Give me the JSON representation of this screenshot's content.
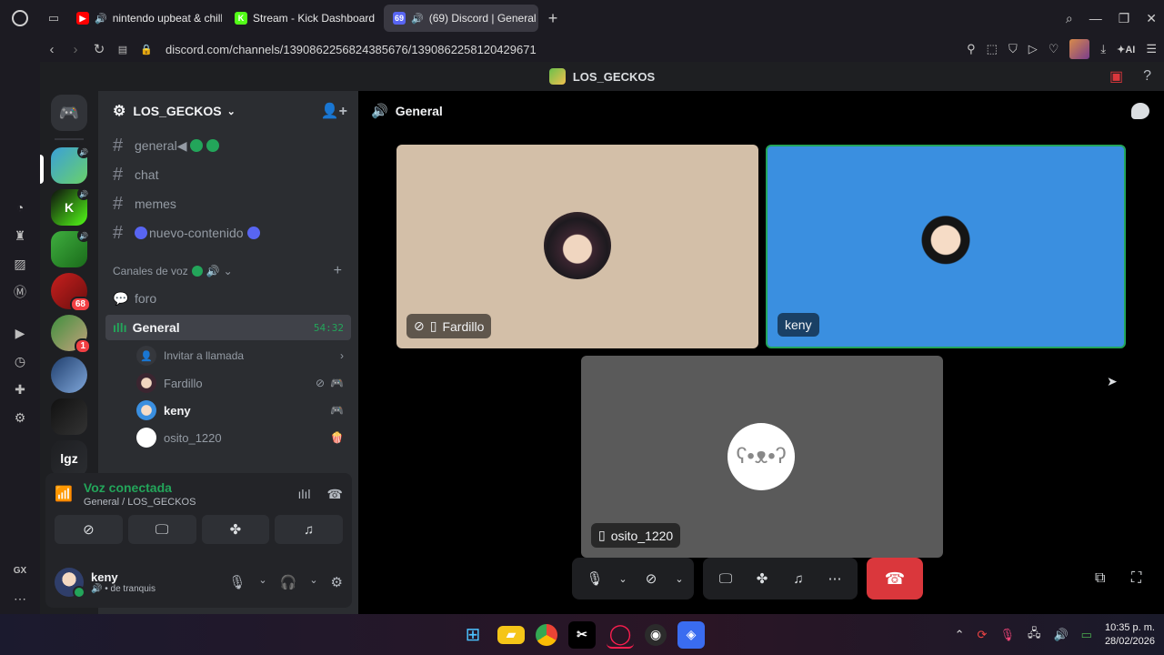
{
  "browser": {
    "tabs": [
      {
        "label": "nintendo upbeat & chill",
        "icon": "youtube-icon",
        "color": "#ff0000",
        "glyph": "▶",
        "audio": true
      },
      {
        "label": "Stream - Kick Dashboard",
        "icon": "kick-icon",
        "color": "#53fc18",
        "glyph": "K",
        "audio": false
      },
      {
        "label": "(69) Discord | General",
        "icon": "discord-icon",
        "color": "#5865f2",
        "glyph": "69",
        "audio": true,
        "active": true
      }
    ],
    "new_tab": "+",
    "url": "discord.com/channels/1390862256824385676/1390862258120429671",
    "ai_label": "AI"
  },
  "discord": {
    "window_title": "LOS_GECKOS",
    "guild_name": "LOS_GECKOS",
    "text_channels": [
      {
        "name": "general◀",
        "dots": [
          "#23a55a",
          "#23a55a"
        ],
        "bold": false
      },
      {
        "name": "chat",
        "dots": []
      },
      {
        "name": "memes",
        "dots": []
      },
      {
        "name": "nuevo-contenido",
        "dots_before": "#5865f2",
        "dots": [
          "#5865f2"
        ]
      }
    ],
    "voice_category": "Canales de voz",
    "forum_channel": "foro",
    "voice_channel": {
      "name": "General",
      "timer": "54:32"
    },
    "invite": "Invitar a llamada",
    "voice_users": [
      {
        "name": "Fardillo",
        "me": false
      },
      {
        "name": "keny",
        "me": true
      },
      {
        "name": "osito_1220",
        "me": false
      }
    ],
    "voice_panel": {
      "status": "Voz conectada",
      "location": "General / LOS_GECKOS"
    },
    "user": {
      "name": "keny",
      "status": "de tranquis"
    },
    "header_channel": "General",
    "servers": [
      {
        "badge": "",
        "colors": [
          "#3aa0d8",
          "#6ad16a"
        ],
        "glyph": ""
      },
      {
        "badge": "",
        "colors": [
          "#0e0e0e",
          "#53fc18"
        ],
        "glyph": "K"
      },
      {
        "badge": "",
        "colors": [
          "#3fae3f",
          "#1a6b1a"
        ],
        "glyph": ""
      },
      {
        "badge": "68",
        "colors": [
          "#c8201e",
          "#6a0e0e"
        ],
        "glyph": ""
      },
      {
        "badge": "1",
        "colors": [
          "#3d8f3d",
          "#c4a27c"
        ],
        "glyph": ""
      },
      {
        "badge": "",
        "colors": [
          "#1f3e6d",
          "#7fa6d9"
        ],
        "glyph": ""
      },
      {
        "badge": "",
        "colors": [
          "#111111",
          "#333333"
        ],
        "glyph": ""
      },
      {
        "badge": "",
        "colors": [
          "#1e1f22",
          "#2b2d31"
        ],
        "glyph": "lgz"
      }
    ],
    "tiles": [
      {
        "name": "Fardillo",
        "bg": "#d3bfa8"
      },
      {
        "name": "keny",
        "bg": "#3a8fe0"
      },
      {
        "name": "osito_1220",
        "bg": "#5a5a5a"
      }
    ]
  },
  "taskbar": {
    "time": "10:35 p. m.",
    "date": "28/02/2026",
    "opera_gx_label": "GX"
  }
}
